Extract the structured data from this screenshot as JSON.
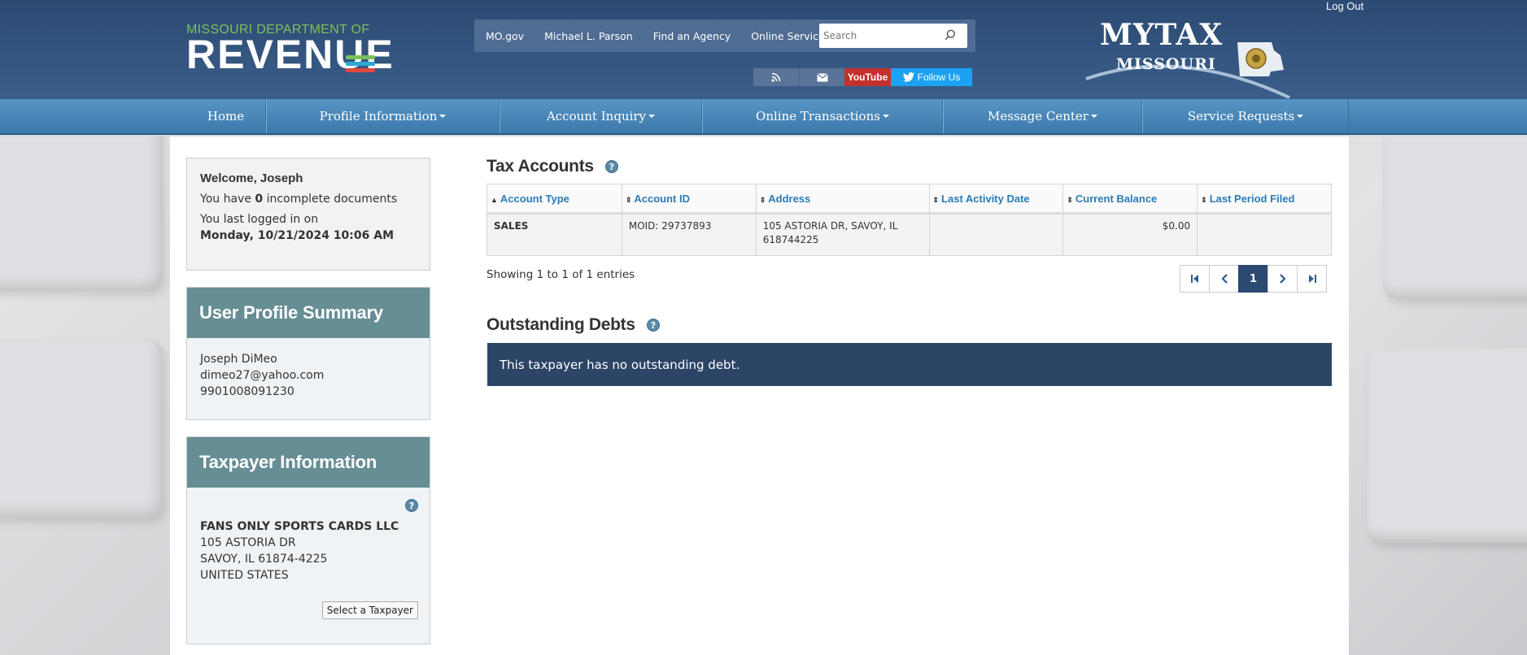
{
  "header": {
    "dor_logo_line1": "MISSOURI DEPARTMENT OF",
    "dor_logo_line2": "REVENUE",
    "links": [
      "MO.gov",
      "Michael L. Parson",
      "Find an Agency",
      "Online Services"
    ],
    "search_placeholder": "Search",
    "social": {
      "youtube": "YouTube",
      "follow": "Follow Us"
    },
    "mytax_line1": "MYTAX",
    "mytax_line2": "MISSOURI",
    "logout": "Log Out"
  },
  "nav": {
    "items": [
      {
        "label": "Home",
        "dropdown": false
      },
      {
        "label": "Profile Information",
        "dropdown": true
      },
      {
        "label": "Account Inquiry",
        "dropdown": true
      },
      {
        "label": "Online Transactions",
        "dropdown": true
      },
      {
        "label": "Message Center",
        "dropdown": true
      },
      {
        "label": "Service Requests",
        "dropdown": true
      }
    ]
  },
  "welcome": {
    "greeting": "Welcome, Joseph",
    "docs_prefix": "You have",
    "docs_count": "0",
    "docs_suffix": "incomplete documents",
    "last_login_label": "You last logged in on",
    "last_login_date": "Monday, 10/21/2024 10:06 AM"
  },
  "profile": {
    "title": "User Profile Summary",
    "name": "Joseph DiMeo",
    "email": "dimeo27@yahoo.com",
    "id": "9901008091230"
  },
  "taxpayer": {
    "title": "Taxpayer Information",
    "business_name": "FANS ONLY SPORTS CARDS LLC",
    "address1": "105 ASTORIA DR",
    "address2": "SAVOY, IL 61874-4225",
    "country": "UNITED STATES",
    "select_button": "Select a Taxpayer"
  },
  "tax_accounts": {
    "title": "Tax Accounts",
    "columns": [
      "Account Type",
      "Account ID",
      "Address",
      "Last Activity Date",
      "Current Balance",
      "Last Period Filed"
    ],
    "rows": [
      {
        "account_type": "SALES",
        "account_id": "MOID: 29737893",
        "address_line1": "105 ASTORIA DR, SAVOY, IL",
        "address_line2": "618744225",
        "last_activity": "",
        "balance": "$0.00",
        "last_period": ""
      }
    ],
    "showing": "Showing 1 to 1 of 1 entries",
    "current_page": "1"
  },
  "outstanding_debts": {
    "title": "Outstanding Debts",
    "message": "This taxpayer has no outstanding debt."
  },
  "colors": {
    "header_bg": "#2b4a72",
    "nav_bg": "#4a86b8",
    "panel_head": "#668e94",
    "link": "#2a7bb8",
    "debt_box": "#2c4466"
  }
}
